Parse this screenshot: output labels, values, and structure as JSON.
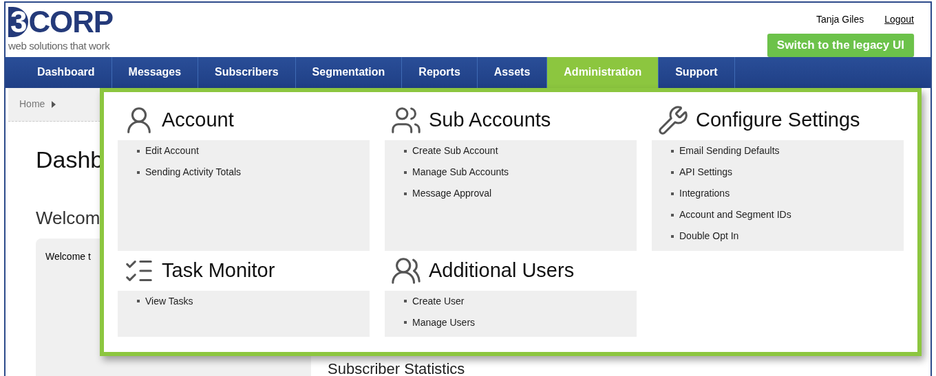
{
  "logo": {
    "mark": "3",
    "name": "CORP",
    "tagline": "web solutions that work"
  },
  "user": {
    "name": "Tanja Giles",
    "logout": "Logout"
  },
  "legacy_button": "Switch to the legacy UI",
  "nav": [
    {
      "label": "Dashboard",
      "selected": false
    },
    {
      "label": "Messages",
      "selected": false
    },
    {
      "label": "Subscribers",
      "selected": false
    },
    {
      "label": "Segmentation",
      "selected": false
    },
    {
      "label": "Reports",
      "selected": false
    },
    {
      "label": "Assets",
      "selected": false
    },
    {
      "label": "Administration",
      "selected": true
    },
    {
      "label": "Support",
      "selected": false
    }
  ],
  "breadcrumb": [
    "Home"
  ],
  "page": {
    "title": "Dashb",
    "welcome_heading": "Welcom",
    "welcome_text": "Welcome t",
    "stats_heading": "Subscriber Statistics"
  },
  "menu": {
    "sections": [
      {
        "kind": "account",
        "title": "Account",
        "items": [
          "Edit Account",
          "Sending Activity Totals"
        ]
      },
      {
        "kind": "sub-accounts",
        "title": "Sub Accounts",
        "items": [
          "Create Sub Account",
          "Manage Sub Accounts",
          "Message Approval"
        ]
      },
      {
        "kind": "settings",
        "title": "Configure Settings",
        "items": [
          "Email Sending Defaults",
          "API Settings",
          "Integrations",
          "Account and Segment IDs",
          "Double Opt In"
        ]
      },
      {
        "kind": "tasks",
        "title": "Task Monitor",
        "items": [
          "View Tasks"
        ]
      },
      {
        "kind": "users",
        "title": "Additional Users",
        "items": [
          "Create User",
          "Manage Users"
        ]
      }
    ]
  }
}
